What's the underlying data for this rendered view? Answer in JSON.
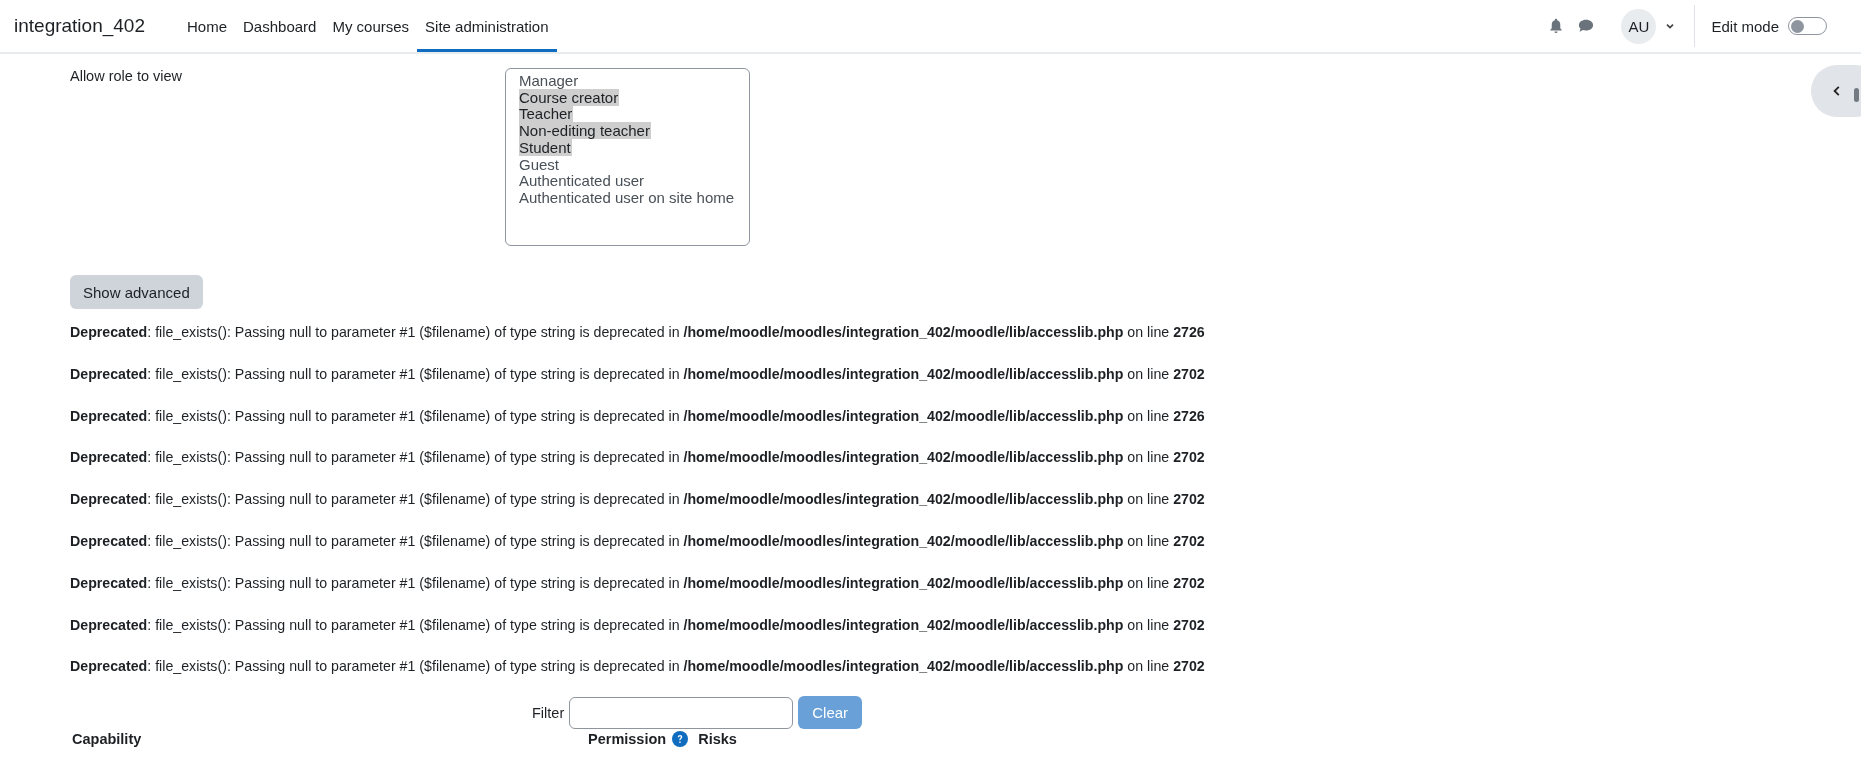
{
  "navbar": {
    "brand": "integration_402",
    "links": [
      {
        "label": "Home",
        "selected": false
      },
      {
        "label": "Dashboard",
        "selected": false
      },
      {
        "label": "My courses",
        "selected": false
      },
      {
        "label": "Site administration",
        "selected": true
      }
    ],
    "avatar": "AU",
    "edit_mode": {
      "label": "Edit mode",
      "on": false
    }
  },
  "allow_role_to_view": {
    "label": "Allow role to view",
    "options": [
      {
        "label": "Manager",
        "selected": false
      },
      {
        "label": "Course creator",
        "selected": true
      },
      {
        "label": "Teacher",
        "selected": true
      },
      {
        "label": "Non-editing teacher",
        "selected": true
      },
      {
        "label": "Student",
        "selected": true
      },
      {
        "label": "Guest",
        "selected": false
      },
      {
        "label": "Authenticated user",
        "selected": false
      },
      {
        "label": "Authenticated user on site home",
        "selected": false
      }
    ]
  },
  "show_advanced_button": "Show advanced",
  "messages": [
    "**Deprecated**: file_exists(): Passing null to parameter #1 ($filename) of type string is deprecated in **/home/moodle/moodles/integration_402/moodle/lib/accesslib.php** on line **2726**",
    "**Deprecated**: file_exists(): Passing null to parameter #1 ($filename) of type string is deprecated in **/home/moodle/moodles/integration_402/moodle/lib/accesslib.php** on line **2702**",
    "**Deprecated**: file_exists(): Passing null to parameter #1 ($filename) of type string is deprecated in **/home/moodle/moodles/integration_402/moodle/lib/accesslib.php** on line **2726**",
    "**Deprecated**: file_exists(): Passing null to parameter #1 ($filename) of type string is deprecated in **/home/moodle/moodles/integration_402/moodle/lib/accesslib.php** on line **2702**",
    "**Deprecated**: file_exists(): Passing null to parameter #1 ($filename) of type string is deprecated in **/home/moodle/moodles/integration_402/moodle/lib/accesslib.php** on line **2702**",
    "**Deprecated**: file_exists(): Passing null to parameter #1 ($filename) of type string is deprecated in **/home/moodle/moodles/integration_402/moodle/lib/accesslib.php** on line **2702**",
    "**Deprecated**: file_exists(): Passing null to parameter #1 ($filename) of type string is deprecated in **/home/moodle/moodles/integration_402/moodle/lib/accesslib.php** on line **2702**",
    "**Deprecated**: file_exists(): Passing null to parameter #1 ($filename) of type string is deprecated in **/home/moodle/moodles/integration_402/moodle/lib/accesslib.php** on line **2702**",
    "**Deprecated**: file_exists(): Passing null to parameter #1 ($filename) of type string is deprecated in **/home/moodle/moodles/integration_402/moodle/lib/accesslib.php** on line **2702**"
  ],
  "filter": {
    "label": "Filter",
    "button": "Clear"
  },
  "table": {
    "columns": [
      "Capability",
      "Permission",
      "Risks"
    ]
  }
}
